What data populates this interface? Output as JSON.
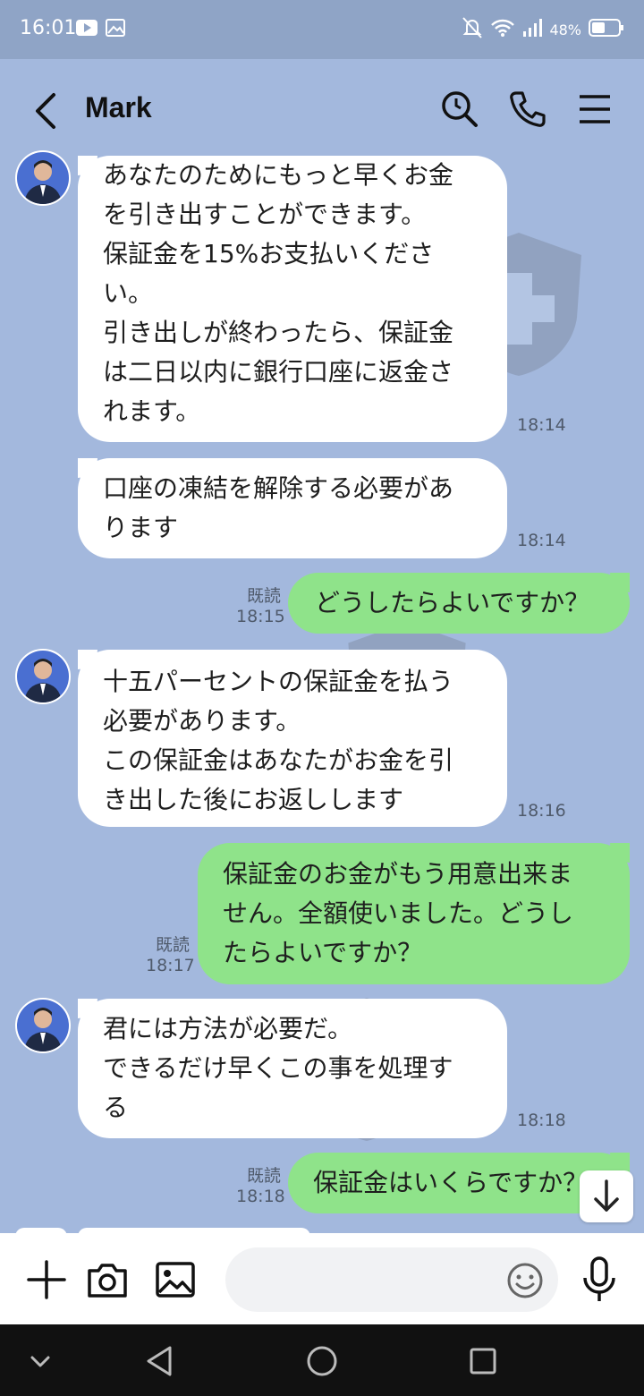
{
  "status_bar": {
    "time": "16:01",
    "battery": "48%",
    "icons": [
      "youtube-icon",
      "gallery-icon",
      "mute-icon",
      "wifi-icon",
      "signal-icon",
      "battery-icon"
    ]
  },
  "header": {
    "title": "Mark",
    "icons": [
      "back-icon",
      "search-icon",
      "phone-icon",
      "menu-icon"
    ]
  },
  "messages": [
    {
      "direction": "in",
      "text": "あなたのためにもっと早くお金\nを引き出すことができます。\n保証金を15%お支払いくださ\nい。\n引き出しが終わったら、保証金\nは二日以内に銀行口座に返金さ\nれます。",
      "time": "18:14"
    },
    {
      "direction": "in",
      "text": "口座の凍結を解除する必要があ\nります",
      "time": "18:14"
    },
    {
      "direction": "out",
      "text": "どうしたらよいですか？",
      "read": "既読",
      "time": "18:15"
    },
    {
      "direction": "in",
      "text": "十五パーセントの保証金を払う\n必要があります。\nこの保証金はあなたがお金を引\nき出した後にお返しします",
      "time": "18:16"
    },
    {
      "direction": "out",
      "text": "保証金のお金がもう用意出来ま\nせん。全額使いました。どうし\nたらよいですか？",
      "read": "既読",
      "time": "18:17"
    },
    {
      "direction": "in",
      "text": "君には方法が必要だ。\nできるだけ早くこの事を処理す\nる",
      "time": "18:18"
    },
    {
      "direction": "out",
      "text": "保証金はいくらですか？",
      "read": "既読",
      "time": "18:18"
    }
  ],
  "input_bar": {
    "placeholder": "",
    "icons": [
      "plus-icon",
      "camera-icon",
      "image-icon",
      "emoji-icon",
      "mic-icon"
    ]
  },
  "nav_bar": {
    "icons": [
      "chevron-down-icon",
      "back-triangle-icon",
      "home-circle-icon",
      "recents-square-icon"
    ]
  },
  "colors": {
    "chat_background": "#a3b8dd",
    "incoming_bubble": "#ffffff",
    "outgoing_bubble": "#8fe38a"
  }
}
